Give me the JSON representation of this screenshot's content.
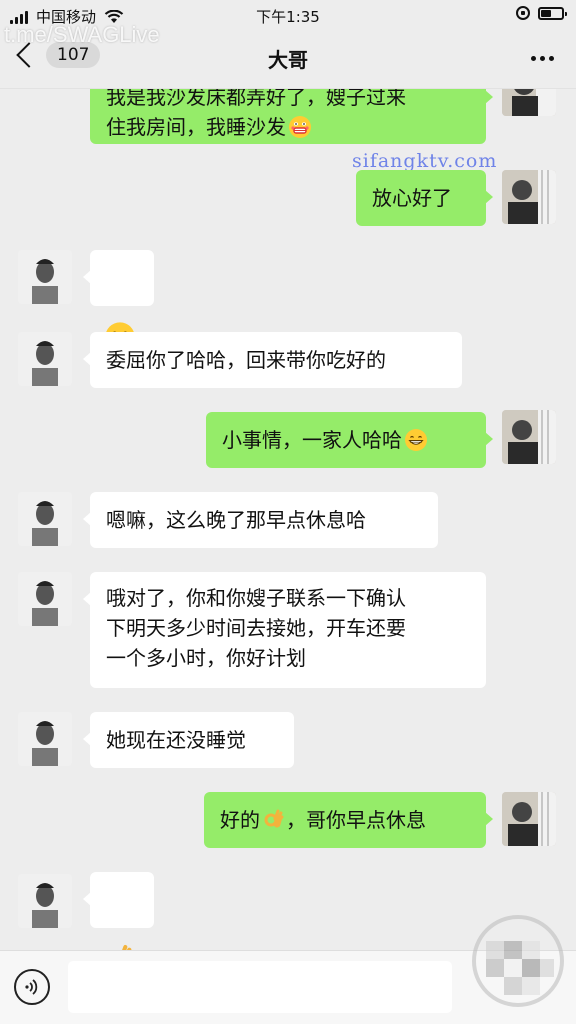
{
  "status_bar": {
    "carrier": "中国移动",
    "time": "下午1:35"
  },
  "watermark_top": "t.me/SWAGLive",
  "watermark_mid": "sifangktv.com",
  "header": {
    "unread_count": "107",
    "title": "大哥"
  },
  "messages": [
    {
      "side": "right",
      "text": "我是我沙发床都弄好了，嫂子过来\n住我房间，我睡沙发",
      "emoji": "grimace-emoji"
    },
    {
      "side": "right",
      "text": "放心好了"
    },
    {
      "side": "left",
      "text": "",
      "emoji": "grin-emoji"
    },
    {
      "side": "left",
      "text": "委屈你了哈哈，回来带你吃好的"
    },
    {
      "side": "right",
      "text": "小事情，一家人哈哈",
      "emoji": "grin-emoji"
    },
    {
      "side": "left",
      "text": "嗯嘛，这么晚了那早点休息哈"
    },
    {
      "side": "left",
      "text": "哦对了，你和你嫂子联系一下确认\n下明天多少时间去接她，开车还要\n一个多小时，你好计划"
    },
    {
      "side": "left",
      "text": "她现在还没睡觉"
    },
    {
      "side": "right",
      "text": "好的",
      "emoji": "ok-hand-emoji",
      "text_after": "，哥你早点休息"
    },
    {
      "side": "left",
      "text": "",
      "emoji": "ok-hand-emoji"
    }
  ],
  "colors": {
    "background": "#ededed",
    "bubble_sent": "#95ec69",
    "bubble_received": "#ffffff"
  }
}
